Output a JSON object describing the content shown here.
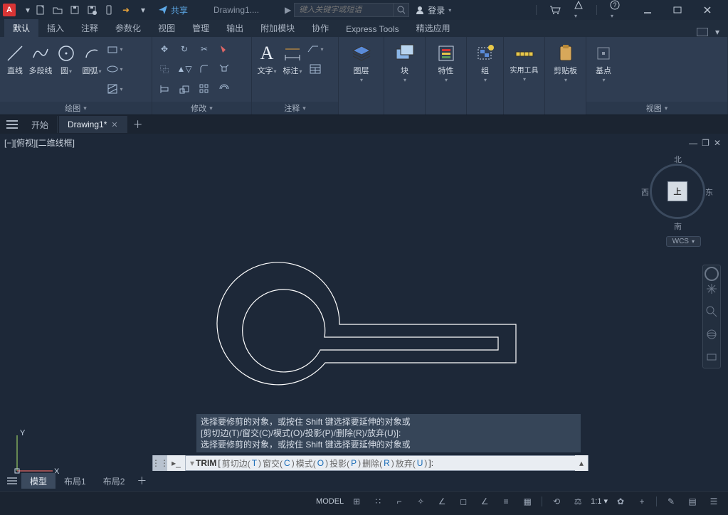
{
  "titlebar": {
    "app_letter": "A",
    "share": "共享",
    "doc": "Drawing1....",
    "search_placeholder": "键入关键字或短语",
    "signin": "登录"
  },
  "ribbon_tabs": [
    "默认",
    "插入",
    "注释",
    "参数化",
    "视图",
    "管理",
    "输出",
    "附加模块",
    "协作",
    "Express Tools",
    "精选应用"
  ],
  "panels": {
    "draw": {
      "title": "绘图",
      "items": {
        "line": "直线",
        "pline": "多段线",
        "circle": "圆",
        "arc": "圆弧"
      }
    },
    "modify": {
      "title": "修改"
    },
    "annot": {
      "title": "注释",
      "items": {
        "text": "文字",
        "dim": "标注",
        "table": "囯"
      }
    },
    "layer": {
      "title": "图层"
    },
    "block": {
      "title": "块"
    },
    "prop": {
      "title": "特性"
    },
    "group": {
      "title": "组"
    },
    "util": {
      "title": "实用工具"
    },
    "clip": {
      "title": "剪贴板"
    },
    "view": {
      "title": "视图",
      "base": "基点"
    }
  },
  "doctabs": {
    "start": "开始",
    "file": "Drawing1*"
  },
  "viewport_label": "[−][俯视][二维线框]",
  "viewcube": {
    "n": "北",
    "s": "南",
    "e": "东",
    "w": "西",
    "top": "上",
    "wcs": "WCS"
  },
  "ucs": {
    "y": "Y",
    "x": "X"
  },
  "cmd_history": [
    "选择要修剪的对象，或按住 Shift 键选择要延伸的对象或",
    "[剪切边(T)/窗交(C)/模式(O)/投影(P)/删除(R)/放弃(U)]:",
    "选择要修剪的对象，或按住 Shift 键选择要延伸的对象或"
  ],
  "cmdline": {
    "cmd": "TRIM",
    "opts": [
      {
        "t": "剪切边",
        "k": "T"
      },
      {
        "t": "窗交",
        "k": "C"
      },
      {
        "t": "模式",
        "k": "O"
      },
      {
        "t": "投影",
        "k": "P"
      },
      {
        "t": "删除",
        "k": "R"
      },
      {
        "t": "放弃",
        "k": "U"
      }
    ]
  },
  "layout_tabs": {
    "model": "模型",
    "l1": "布局1",
    "l2": "布局2"
  },
  "status": {
    "scale": "1:1",
    "model": "MODEL",
    "gear": "⚙"
  }
}
